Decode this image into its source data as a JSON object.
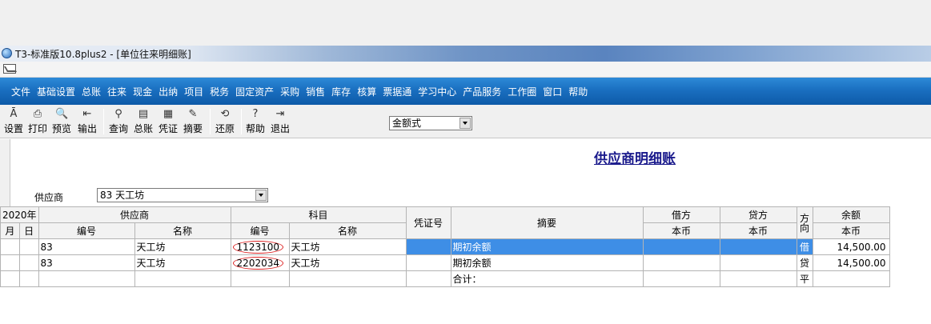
{
  "window": {
    "title": "T3-标准版10.8plus2 - [单位往来明细账]"
  },
  "menu": {
    "items": [
      "文件",
      "基础设置",
      "总账",
      "往来",
      "现金",
      "出纳",
      "项目",
      "税务",
      "固定资产",
      "采购",
      "销售",
      "库存",
      "核算",
      "票据通",
      "学习中心",
      "产品服务",
      "工作圈",
      "窗口",
      "帮助"
    ]
  },
  "toolbar": {
    "buttons": [
      {
        "label": "设置",
        "icon": "settings-icon",
        "glyph": "Ā"
      },
      {
        "label": "打印",
        "icon": "print-icon",
        "glyph": "⎙"
      },
      {
        "label": "预览",
        "icon": "preview-icon",
        "glyph": "🔍"
      },
      {
        "label": "输出",
        "icon": "export-icon",
        "glyph": "⇤"
      },
      {
        "label": "查询",
        "icon": "query-icon",
        "glyph": "⚲"
      },
      {
        "label": "总账",
        "icon": "ledger-icon",
        "glyph": "▤"
      },
      {
        "label": "凭证",
        "icon": "voucher-icon",
        "glyph": "▦"
      },
      {
        "label": "摘要",
        "icon": "summary-icon",
        "glyph": "✎"
      },
      {
        "label": "还原",
        "icon": "restore-icon",
        "glyph": "⟲"
      },
      {
        "label": "帮助",
        "icon": "help-icon",
        "glyph": "?"
      },
      {
        "label": "退出",
        "icon": "exit-icon",
        "glyph": "⇥"
      }
    ],
    "format_select": "金额式"
  },
  "report": {
    "title": "供应商明细账",
    "supplier_label": "供应商",
    "supplier_value": "83   天工坊"
  },
  "grid": {
    "year": "2020年",
    "month": "月",
    "day": "日",
    "supplier_group": "供应商",
    "subject_group": "科目",
    "code": "编号",
    "name": "名称",
    "voucher_no": "凭证号",
    "summary": "摘要",
    "debit": "借方",
    "credit": "贷方",
    "direction": "方向",
    "balance": "余额",
    "currency": "本币",
    "rows": [
      {
        "supplier_code": "83",
        "supplier_name": "天工坊",
        "subject_code": "1123100",
        "subject_name": "天工坊",
        "summary": "期初余额",
        "direction": "借",
        "balance": "14,500.00"
      },
      {
        "supplier_code": "83",
        "supplier_name": "天工坊",
        "subject_code": "2202034",
        "subject_name": "天工坊",
        "summary": "期初余额",
        "direction": "贷",
        "balance": "14,500.00"
      }
    ],
    "total": {
      "summary": "合计：",
      "direction": "平"
    }
  }
}
